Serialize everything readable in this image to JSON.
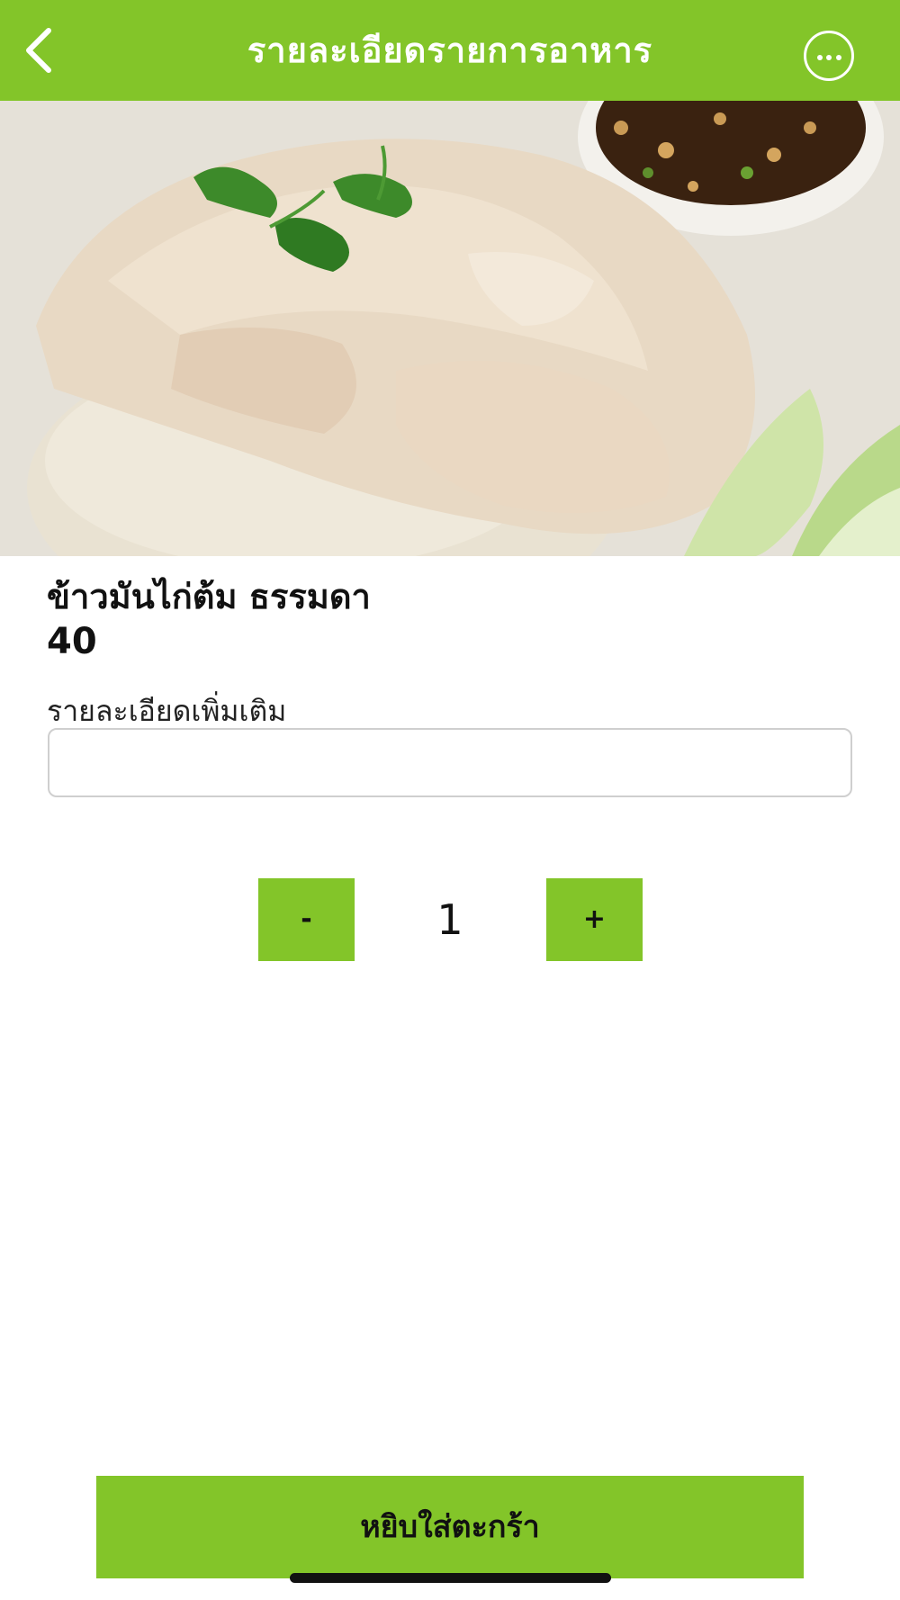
{
  "header": {
    "title": "รายละเอียดรายการอาหาร",
    "back_icon": "chevron-left-icon",
    "more_icon": "ellipsis-circle-icon",
    "background_color": "#83c529"
  },
  "item": {
    "name": "ข้าวมันไก่ต้ม ธรรมดา",
    "price": "40"
  },
  "details": {
    "label": "รายละเอียดเพิ่มเติม",
    "value": "",
    "placeholder": ""
  },
  "quantity": {
    "minus_label": "-",
    "value": "1",
    "plus_label": "+"
  },
  "footer": {
    "add_to_cart_label": "หยิบใส่ตะกร้า"
  },
  "colors": {
    "accent": "#83c529",
    "text": "#111111"
  }
}
